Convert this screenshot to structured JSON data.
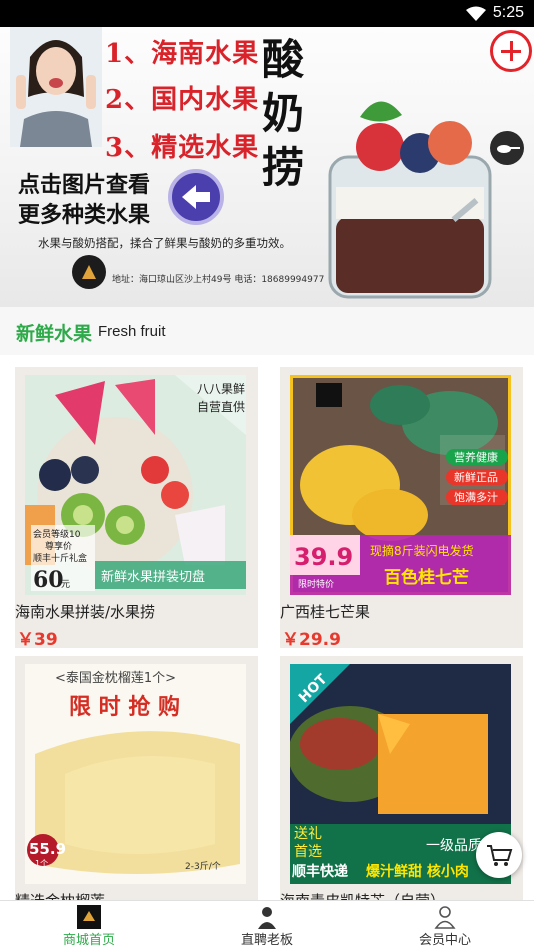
{
  "status_bar": {
    "time": "5:25"
  },
  "banner": {
    "lines": [
      "1、海南水果",
      "2、国内水果",
      "3、精选水果"
    ],
    "vertical_title": "酸奶捞",
    "cta_line1": "点击图片查看",
    "cta_line2": "更多种类水果",
    "description": "水果与酸奶搭配，揉合了鲜果与酸奶的多重功效。",
    "address": "地址：海口琼山区沙上村49号   电话：18689994977"
  },
  "section": {
    "title_cn": "新鲜水果",
    "title_en": "Fresh fruit"
  },
  "products": [
    {
      "name": "海南水果拼装/水果捞",
      "price": "￥39",
      "overlay": {
        "tag1": "八八果鲜",
        "tag2": "自营直供",
        "promo1": "会员等级10",
        "promo2": "尊享价",
        "promo3": "顺丰十斤礼盒",
        "big_price": "60",
        "unit": "元",
        "banner": "新鲜水果拼装切盘"
      }
    },
    {
      "name": "广西桂七芒果",
      "price": "￥29.9",
      "overlay": {
        "tag1": "营养健康",
        "tag2": "新鲜正品",
        "tag3": "饱满多汁",
        "big_price": "39.9",
        "limit": "限时特价",
        "ship": "现摘8斤装闪电发货",
        "banner": "百色桂七芒"
      }
    },
    {
      "name": "精选金枕榴莲",
      "price": "",
      "overlay": {
        "top": "<泰国金枕榴莲1个>",
        "headline": "限 时 抢 购",
        "big_price": "55.9",
        "unit": "1个",
        "weight": "2-3斤/个"
      }
    },
    {
      "name": "海南青皮凯特芒（自营）",
      "price": "",
      "overlay": {
        "hot": "HOT",
        "gift": "送礼",
        "first": "首选",
        "grade": "一级品质",
        "ship": "顺丰快递",
        "slogan": "爆汁鲜甜 核小肉"
      }
    }
  ],
  "tabbar": {
    "tabs": [
      {
        "label": "商城首页"
      },
      {
        "label": "直聘老板"
      },
      {
        "label": "会员中心"
      }
    ]
  },
  "colors": {
    "accent_green": "#2eaa4a",
    "price_red": "#e8392d",
    "brand_red": "#d8232a"
  }
}
